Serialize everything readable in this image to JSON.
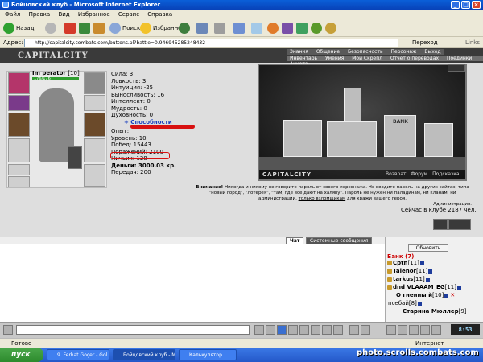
{
  "window": {
    "title": "Бойцовский клуб - Microsoft Internet Explorer"
  },
  "menu": [
    "Файл",
    "Правка",
    "Вид",
    "Избранное",
    "Сервис",
    "Справка"
  ],
  "toolbar": {
    "back": "Назад",
    "search": "Поиск",
    "favorites": "Избранное"
  },
  "address": {
    "label": "Адрес:",
    "url": "http://capitalcity.combats.com/buttons.pl?battle=0.946945285248432",
    "go": "Переход",
    "links": "Links"
  },
  "game_nav": {
    "logo": "CAPITALCITY",
    "row1": [
      "Знания",
      "Общение",
      "Безопасность",
      "Персонаж",
      "Выход"
    ],
    "row2": [
      "Инвентарь",
      "Умения",
      "Мой Скрепл",
      "Отчет о переводах",
      "Поединки",
      "Анкета"
    ]
  },
  "character": {
    "name": "Im perator",
    "level": "[10]",
    "hp": "176/176",
    "stats": [
      {
        "label": "Сила:",
        "value": "3"
      },
      {
        "label": "Ловкость:",
        "value": "3"
      },
      {
        "label": "Интуиция:",
        "value": "-25"
      },
      {
        "label": "Выносливость:",
        "value": "16"
      },
      {
        "label": "Интеллект:",
        "value": "0"
      },
      {
        "label": "Мудрость:",
        "value": "0"
      },
      {
        "label": "Духовность:",
        "value": "0"
      }
    ],
    "abilities": "+ Способности",
    "experience_label": "Опыт:",
    "records": [
      {
        "label": "Уровень:",
        "value": "10"
      },
      {
        "label": "Побед:",
        "value": "15443"
      },
      {
        "label": "Поражений:",
        "value": "2100"
      },
      {
        "label": "Ничьих:",
        "value": "128"
      }
    ],
    "money": "Деньги: 3000.03 кр.",
    "transfers": "Передач: 200"
  },
  "city": {
    "logo": "CAPITALCITY",
    "nav": [
      "Возврат",
      "Форум",
      "Подсказка"
    ],
    "bank_sign": "BANK"
  },
  "warning": {
    "lead": "Внимание!",
    "text": "Никогда и никому не говорите пароль от своего персонажа. Не вводите пароль на других сайтах, типа \"новый город\", \"лотерея\", \"там, где все дают на халяву\". Пароль не нужен ни паладинам, ни кланам, ни администрации,",
    "link": "только взломщикам",
    "tail": "для кражи вашего героя.",
    "signature": "Администрация.",
    "online": "Сейчас в клубе 2187 чел."
  },
  "chat": {
    "tab_chat": "Чат",
    "tab_system": "Системные сообщения"
  },
  "roster": {
    "refresh": "Обновить",
    "room": "Банк (7)",
    "players": [
      {
        "name": "Cptn",
        "level": "[11]"
      },
      {
        "name": "Talenor",
        "level": "[11]"
      },
      {
        "name": "tarkus",
        "level": "[11]"
      },
      {
        "name": "dnd VLAAAM_EG",
        "level": "[11]"
      },
      {
        "name": "О гненны й",
        "level": "[10]"
      },
      {
        "name": "псебай",
        "level": "[8]"
      },
      {
        "name": "Старина Мюллер",
        "level": "[9]"
      }
    ]
  },
  "clock": "8:53",
  "status": {
    "left": "Готово",
    "right": "Интернет"
  },
  "taskbar": {
    "start": "пуск",
    "tasks": [
      "9. Ferhat Goçer - Gol...",
      "Бойцовский клуб - M...",
      "Калькулятор"
    ]
  },
  "watermark": "photo.scrolls.combats.com"
}
